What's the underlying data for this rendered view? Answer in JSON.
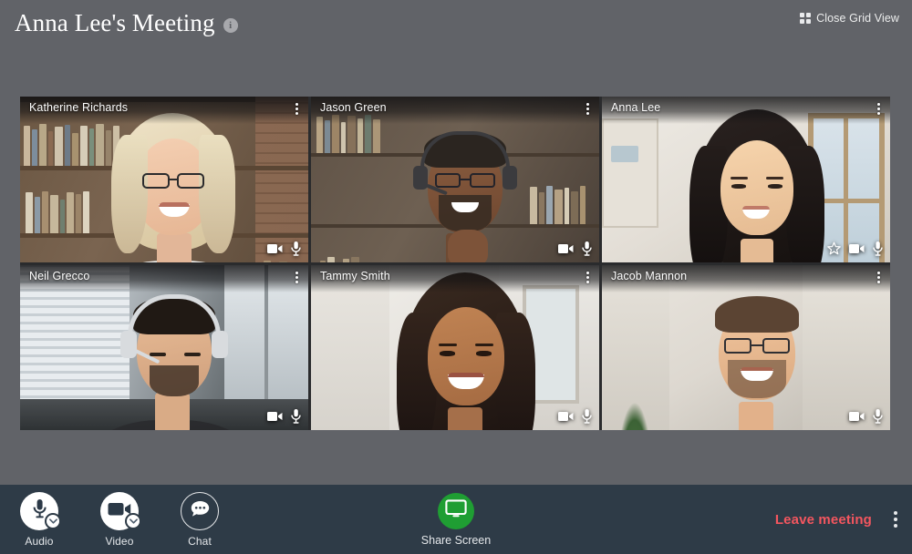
{
  "header": {
    "title": "Anna Lee's Meeting",
    "info_icon": "info-icon",
    "info_glyph": "i",
    "close_grid_view_label": "Close Grid View",
    "grid_icon": "grid-icon"
  },
  "colors": {
    "page_background": "#616368",
    "toolbar_background": "#2e3b47",
    "active_speaker_border": "#4a8fd8",
    "share_screen_accent": "#1f9e33",
    "leave_meeting_accent": "#f4565f",
    "label_text": "#e4e7ea"
  },
  "grid": {
    "columns": 3,
    "rows": 2,
    "participants": [
      {
        "name": "Katherine Richards",
        "active_speaker": true,
        "pinned": false,
        "icons": [
          "camera-icon",
          "microphone-icon"
        ],
        "menu": "more-options-icon"
      },
      {
        "name": "Jason Green",
        "active_speaker": false,
        "pinned": false,
        "icons": [
          "camera-icon",
          "microphone-icon"
        ],
        "menu": "more-options-icon"
      },
      {
        "name": "Anna Lee",
        "active_speaker": false,
        "pinned": true,
        "icons": [
          "star-icon",
          "camera-icon",
          "microphone-icon"
        ],
        "menu": "more-options-icon"
      },
      {
        "name": "Neil Grecco",
        "active_speaker": false,
        "pinned": false,
        "icons": [
          "camera-icon",
          "microphone-icon"
        ],
        "menu": "more-options-icon"
      },
      {
        "name": "Tammy Smith",
        "active_speaker": false,
        "pinned": false,
        "icons": [
          "camera-icon",
          "microphone-icon"
        ],
        "menu": "more-options-icon"
      },
      {
        "name": "Jacob Mannon",
        "active_speaker": false,
        "pinned": false,
        "icons": [
          "camera-icon",
          "microphone-icon"
        ],
        "menu": "more-options-icon"
      }
    ]
  },
  "toolbar": {
    "audio_label": "Audio",
    "audio_icon": "microphone-icon",
    "audio_dropdown_icon": "chevron-down-icon",
    "video_label": "Video",
    "video_icon": "camera-icon",
    "video_dropdown_icon": "chevron-down-icon",
    "chat_label": "Chat",
    "chat_icon": "chat-bubble-icon",
    "share_screen_label": "Share Screen",
    "share_screen_icon": "monitor-icon",
    "leave_meeting_label": "Leave meeting",
    "more_options_icon": "more-options-icon"
  }
}
